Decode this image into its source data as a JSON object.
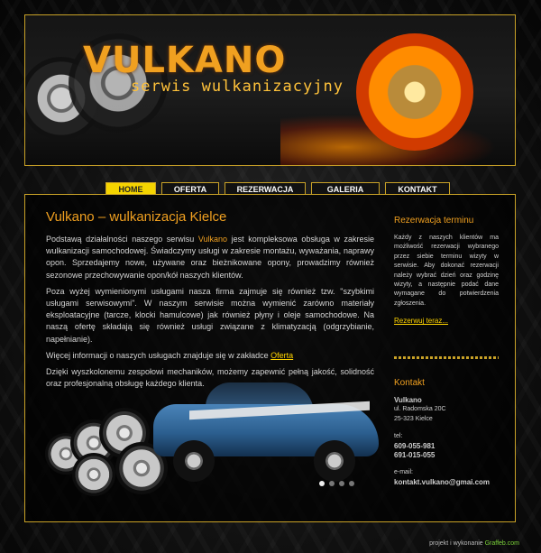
{
  "header": {
    "logo": "VULKANO",
    "slogan": "serwis wulkanizacyjny"
  },
  "nav": {
    "items": [
      "HOME",
      "OFERTA",
      "REZERWACJA",
      "GALERIA",
      "KONTAKT"
    ],
    "active": "HOME"
  },
  "main": {
    "title": "Vulkano – wulkanizacja Kielce",
    "p1_a": "Podstawą działalności naszego serwisu ",
    "p1_brand": "Vulkano",
    "p1_b": " jest kompleksowa obsługa w zakresie wulkanizacji samochodowej. Świadczymy usługi w zakresie montażu, wyważania, naprawy opon. Sprzedajemy nowe, używane oraz bieżnikowane opony, prowadzimy również sezonowe przechowywanie opon/kół naszych klientów.",
    "p2": "Poza wyżej wymienionymi usługami nasza firma zajmuje się również tzw. \"szybkimi usługami serwisowymi\". W naszym serwisie można wymienić zarówno materiały eksploatacyjne (tarcze, klocki hamulcowe) jak również płyny i oleje samochodowe. Na naszą ofertę składają się również usługi związane z klimatyzacją (odgrzybianie, napełnianie).",
    "p3_a": "Więcej informacji o naszych usługach znajduje się w zakładce ",
    "p3_link": "Oferta",
    "p4": "Dzięki wyszkolonemu zespołowi mechaników, możemy zapewnić pełną jakość, solidność oraz profesjonalną obsługę każdego klienta."
  },
  "sidebar": {
    "reservation_title": "Rezerwacja terminu",
    "reservation_text": "Każdy z naszych klientów ma możliwość rezerwacji wybranego przez siebie terminu wizyty w serwisie. Aby dokonać rezerwacji należy wybrać dzień oraz godzinę wizyty, a następnie podać dane wymagane do potwierdzenia zgłoszenia.",
    "reservation_link": "Rezerwuj teraz...",
    "contact_title": "Kontakt",
    "company": "Vulkano",
    "street": "ul. Radomska 20C",
    "city": "25-323 Kielce",
    "tel_label": "tel:",
    "phone1": "609-055-981",
    "phone2": "691-015-055",
    "email_label": "e-mail:",
    "email": "kontakt.vulkano@gmai.com"
  },
  "footer": {
    "text": "projekt i wykonanie ",
    "brand": "Graffeb.com"
  },
  "colors": {
    "accent": "#f0a020",
    "border": "#c9a227",
    "nav_active": "#f5d400"
  }
}
